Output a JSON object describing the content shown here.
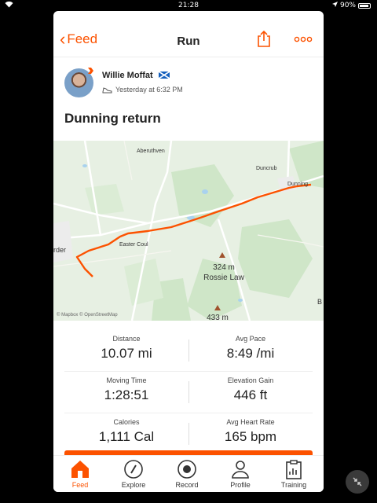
{
  "status_bar": {
    "time": "21:28",
    "battery": "90%"
  },
  "header": {
    "back_label": "Feed",
    "title": "Run"
  },
  "athlete": {
    "name": "Willie Moffat",
    "timestamp": "Yesterday at 6:32 PM"
  },
  "activity": {
    "title": "Dunning return"
  },
  "map": {
    "labels": {
      "aberuthven": "Aberuthven",
      "duncrub": "Duncrub",
      "dunning": "Dunning",
      "easter_coul": "Easter Coul",
      "peak1_height": "324 m",
      "peak1_name": "Rossie Law",
      "peak2_height": "433 m",
      "auchterarder_fragment": "rder",
      "edge_fragment": "B",
      "attribution": "© Mapbox © OpenStreetMap"
    },
    "route_color": "#fc5200"
  },
  "stats": {
    "distance": {
      "label": "Distance",
      "value": "10.07 mi"
    },
    "avg_pace": {
      "label": "Avg Pace",
      "value": "8:49 /mi"
    },
    "moving_time": {
      "label": "Moving Time",
      "value": "1:28:51"
    },
    "elevation_gain": {
      "label": "Elevation Gain",
      "value": "446 ft"
    },
    "calories": {
      "label": "Calories",
      "value": "1,111 Cal"
    },
    "avg_heart_rate": {
      "label": "Avg Heart Rate",
      "value": "165 bpm"
    }
  },
  "tabs": [
    {
      "label": "Feed",
      "icon": "home-icon",
      "active": true
    },
    {
      "label": "Explore",
      "icon": "compass-icon",
      "active": false
    },
    {
      "label": "Record",
      "icon": "record-icon",
      "active": false
    },
    {
      "label": "Profile",
      "icon": "profile-icon",
      "active": false
    },
    {
      "label": "Training",
      "icon": "clipboard-icon",
      "active": false
    }
  ],
  "colors": {
    "accent": "#fc5200",
    "map_bg": "#e7f0e3"
  }
}
